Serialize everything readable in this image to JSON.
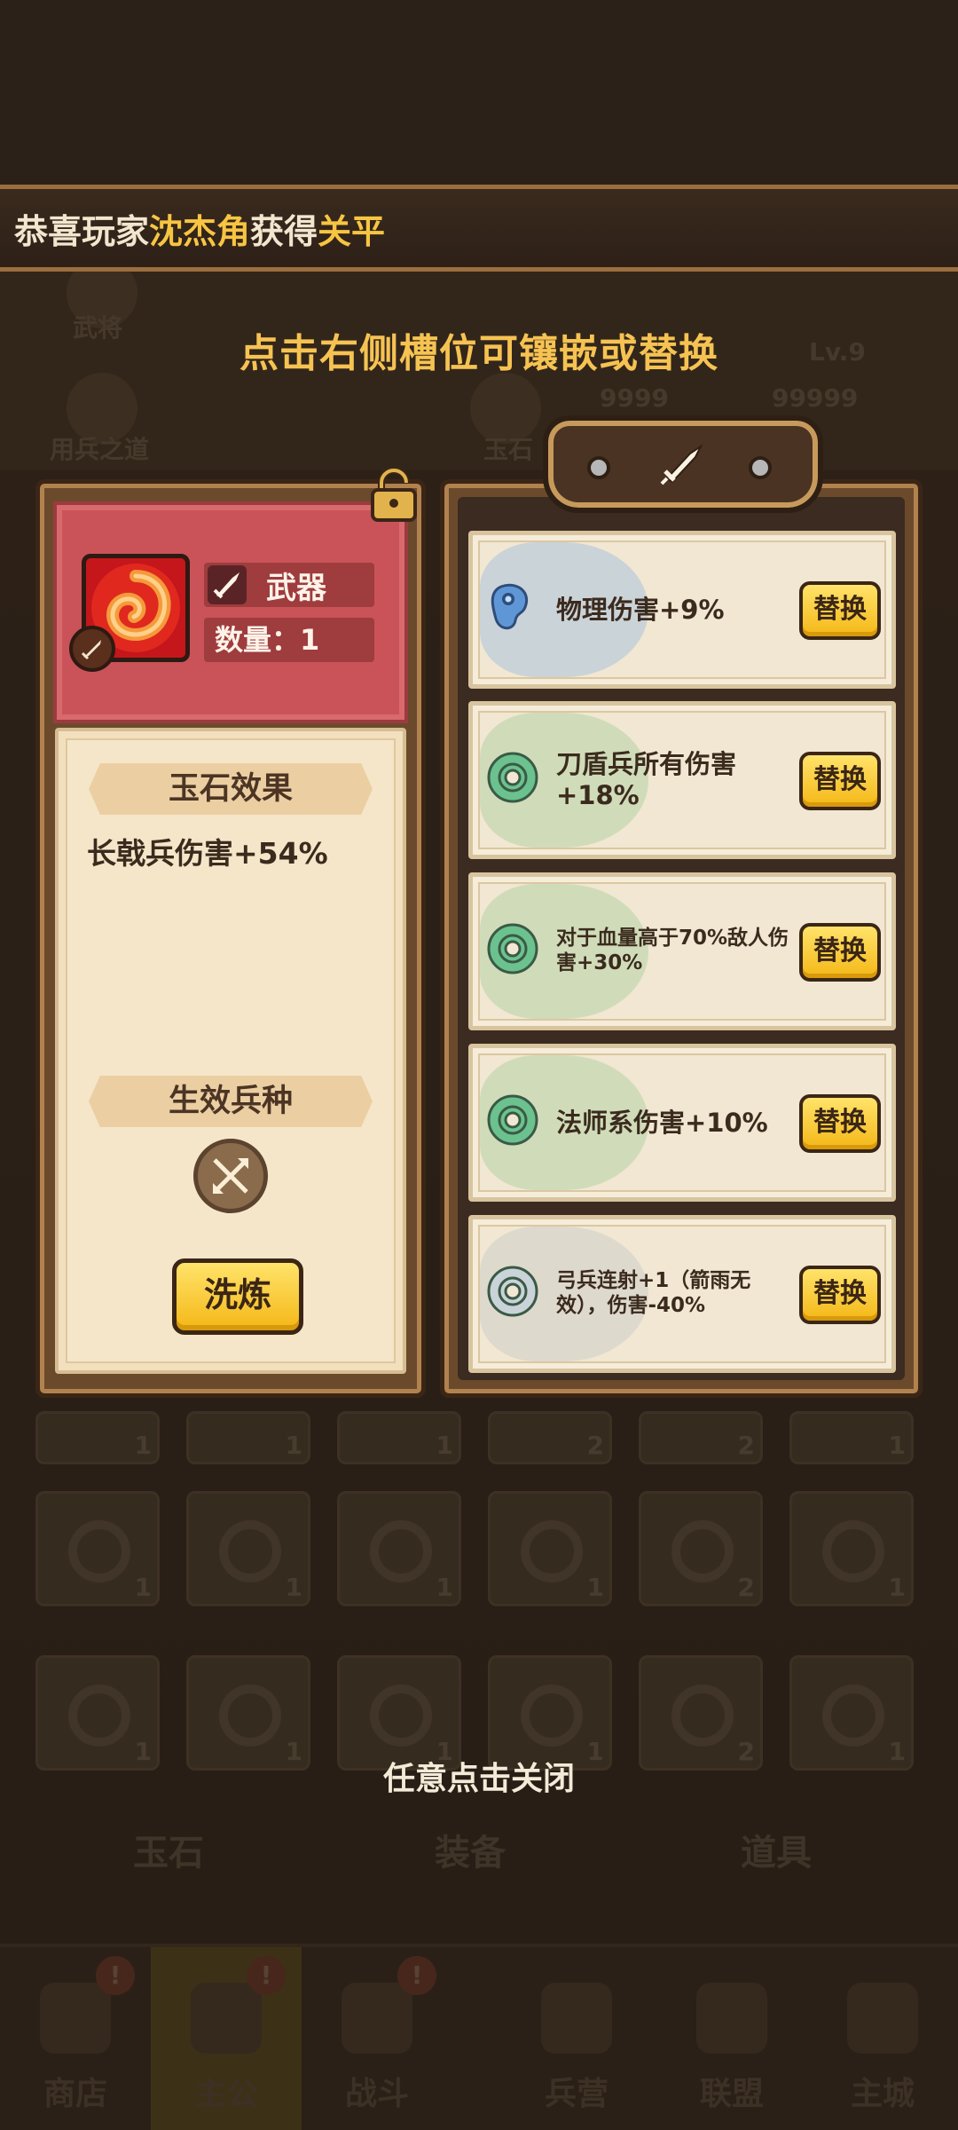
{
  "banner": {
    "prefix": "恭喜玩家",
    "player": "沈杰角",
    "middle": "获得",
    "item": "关平"
  },
  "hint_top": "点击右侧槽位可镶嵌或替换",
  "background": {
    "labels": [
      "武将",
      "用兵之道",
      "玉石"
    ],
    "level": "Lv.9",
    "counts": [
      "9999",
      "99999"
    ],
    "tabs": [
      "玉石",
      "装备",
      "道具"
    ],
    "grid_counts": [
      "1",
      "1",
      "1",
      "2",
      "2",
      "1",
      "1",
      "1",
      "1",
      "1",
      "2",
      "1",
      "1",
      "1",
      "1",
      "1",
      "2",
      "1"
    ]
  },
  "jade": {
    "type_label": "武器",
    "quantity_label": "数量：1",
    "effect_title": "玉石效果",
    "effect_text": "长戟兵伤害+54%",
    "unit_title": "生效兵种",
    "refine_button": "洗炼"
  },
  "attributes": [
    {
      "text": "物理伤害+9%",
      "gem_color": "#5f97d6",
      "wash": "#9bbbe0",
      "button": "替换",
      "small": false
    },
    {
      "text": "刀盾兵所有伤害+18%",
      "gem_color": "#6bc28e",
      "wash": "#a9cf9c",
      "button": "替换",
      "small": false
    },
    {
      "text": "对于血量高于70%敌人伤害+30%",
      "gem_color": "#6bc28e",
      "wash": "#a9cf9c",
      "button": "替换",
      "small": true
    },
    {
      "text": "法师系伤害+10%",
      "gem_color": "#6bc28e",
      "wash": "#a9cf9c",
      "button": "替换",
      "small": false
    },
    {
      "text": "弓兵连射+1（箭雨无效），伤害-40%",
      "gem_color": "#c9d3d8",
      "wash": "#c8c8c8",
      "button": "替换",
      "small": true
    }
  ],
  "close_hint": "任意点击关闭",
  "nav": [
    {
      "label": "商店",
      "badge": "!"
    },
    {
      "label": "主公",
      "badge": "!",
      "active": true
    },
    {
      "label": "战斗",
      "badge": "!"
    },
    {
      "label": "兵营"
    },
    {
      "label": "联盟"
    },
    {
      "label": "主城"
    }
  ],
  "colors": {
    "accent_yellow": "#f7c542",
    "button_yellow": "#f4b716",
    "header_red": "#c95358",
    "paper": "#f5e6c9"
  }
}
